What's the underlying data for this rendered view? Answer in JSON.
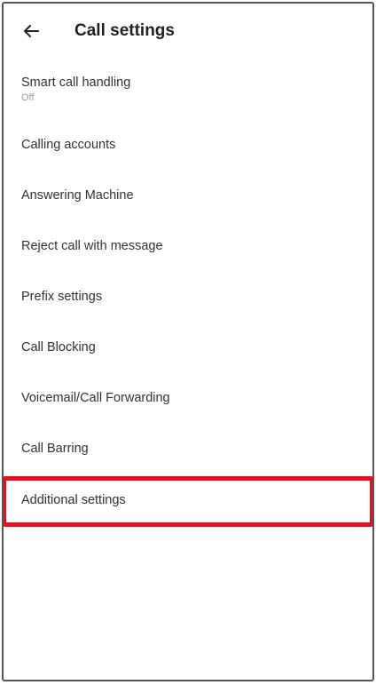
{
  "app_bar": {
    "back_icon": "arrow-left-icon",
    "title": "Call settings"
  },
  "settings": [
    {
      "id": "smart-call-handling",
      "label": "Smart call handling",
      "sublabel": "Off"
    },
    {
      "id": "calling-accounts",
      "label": "Calling accounts"
    },
    {
      "id": "answering-machine",
      "label": "Answering Machine"
    },
    {
      "id": "reject-call-with-message",
      "label": "Reject call with message"
    },
    {
      "id": "prefix-settings",
      "label": "Prefix settings"
    },
    {
      "id": "call-blocking",
      "label": "Call Blocking"
    },
    {
      "id": "voicemail-call-forwarding",
      "label": "Voicemail/Call Forwarding"
    },
    {
      "id": "call-barring",
      "label": "Call Barring"
    },
    {
      "id": "additional-settings",
      "label": "Additional settings",
      "highlighted": true
    }
  ],
  "colors": {
    "highlight": "#e8101e",
    "text": "#333333",
    "subtext": "#9a9a9a"
  }
}
